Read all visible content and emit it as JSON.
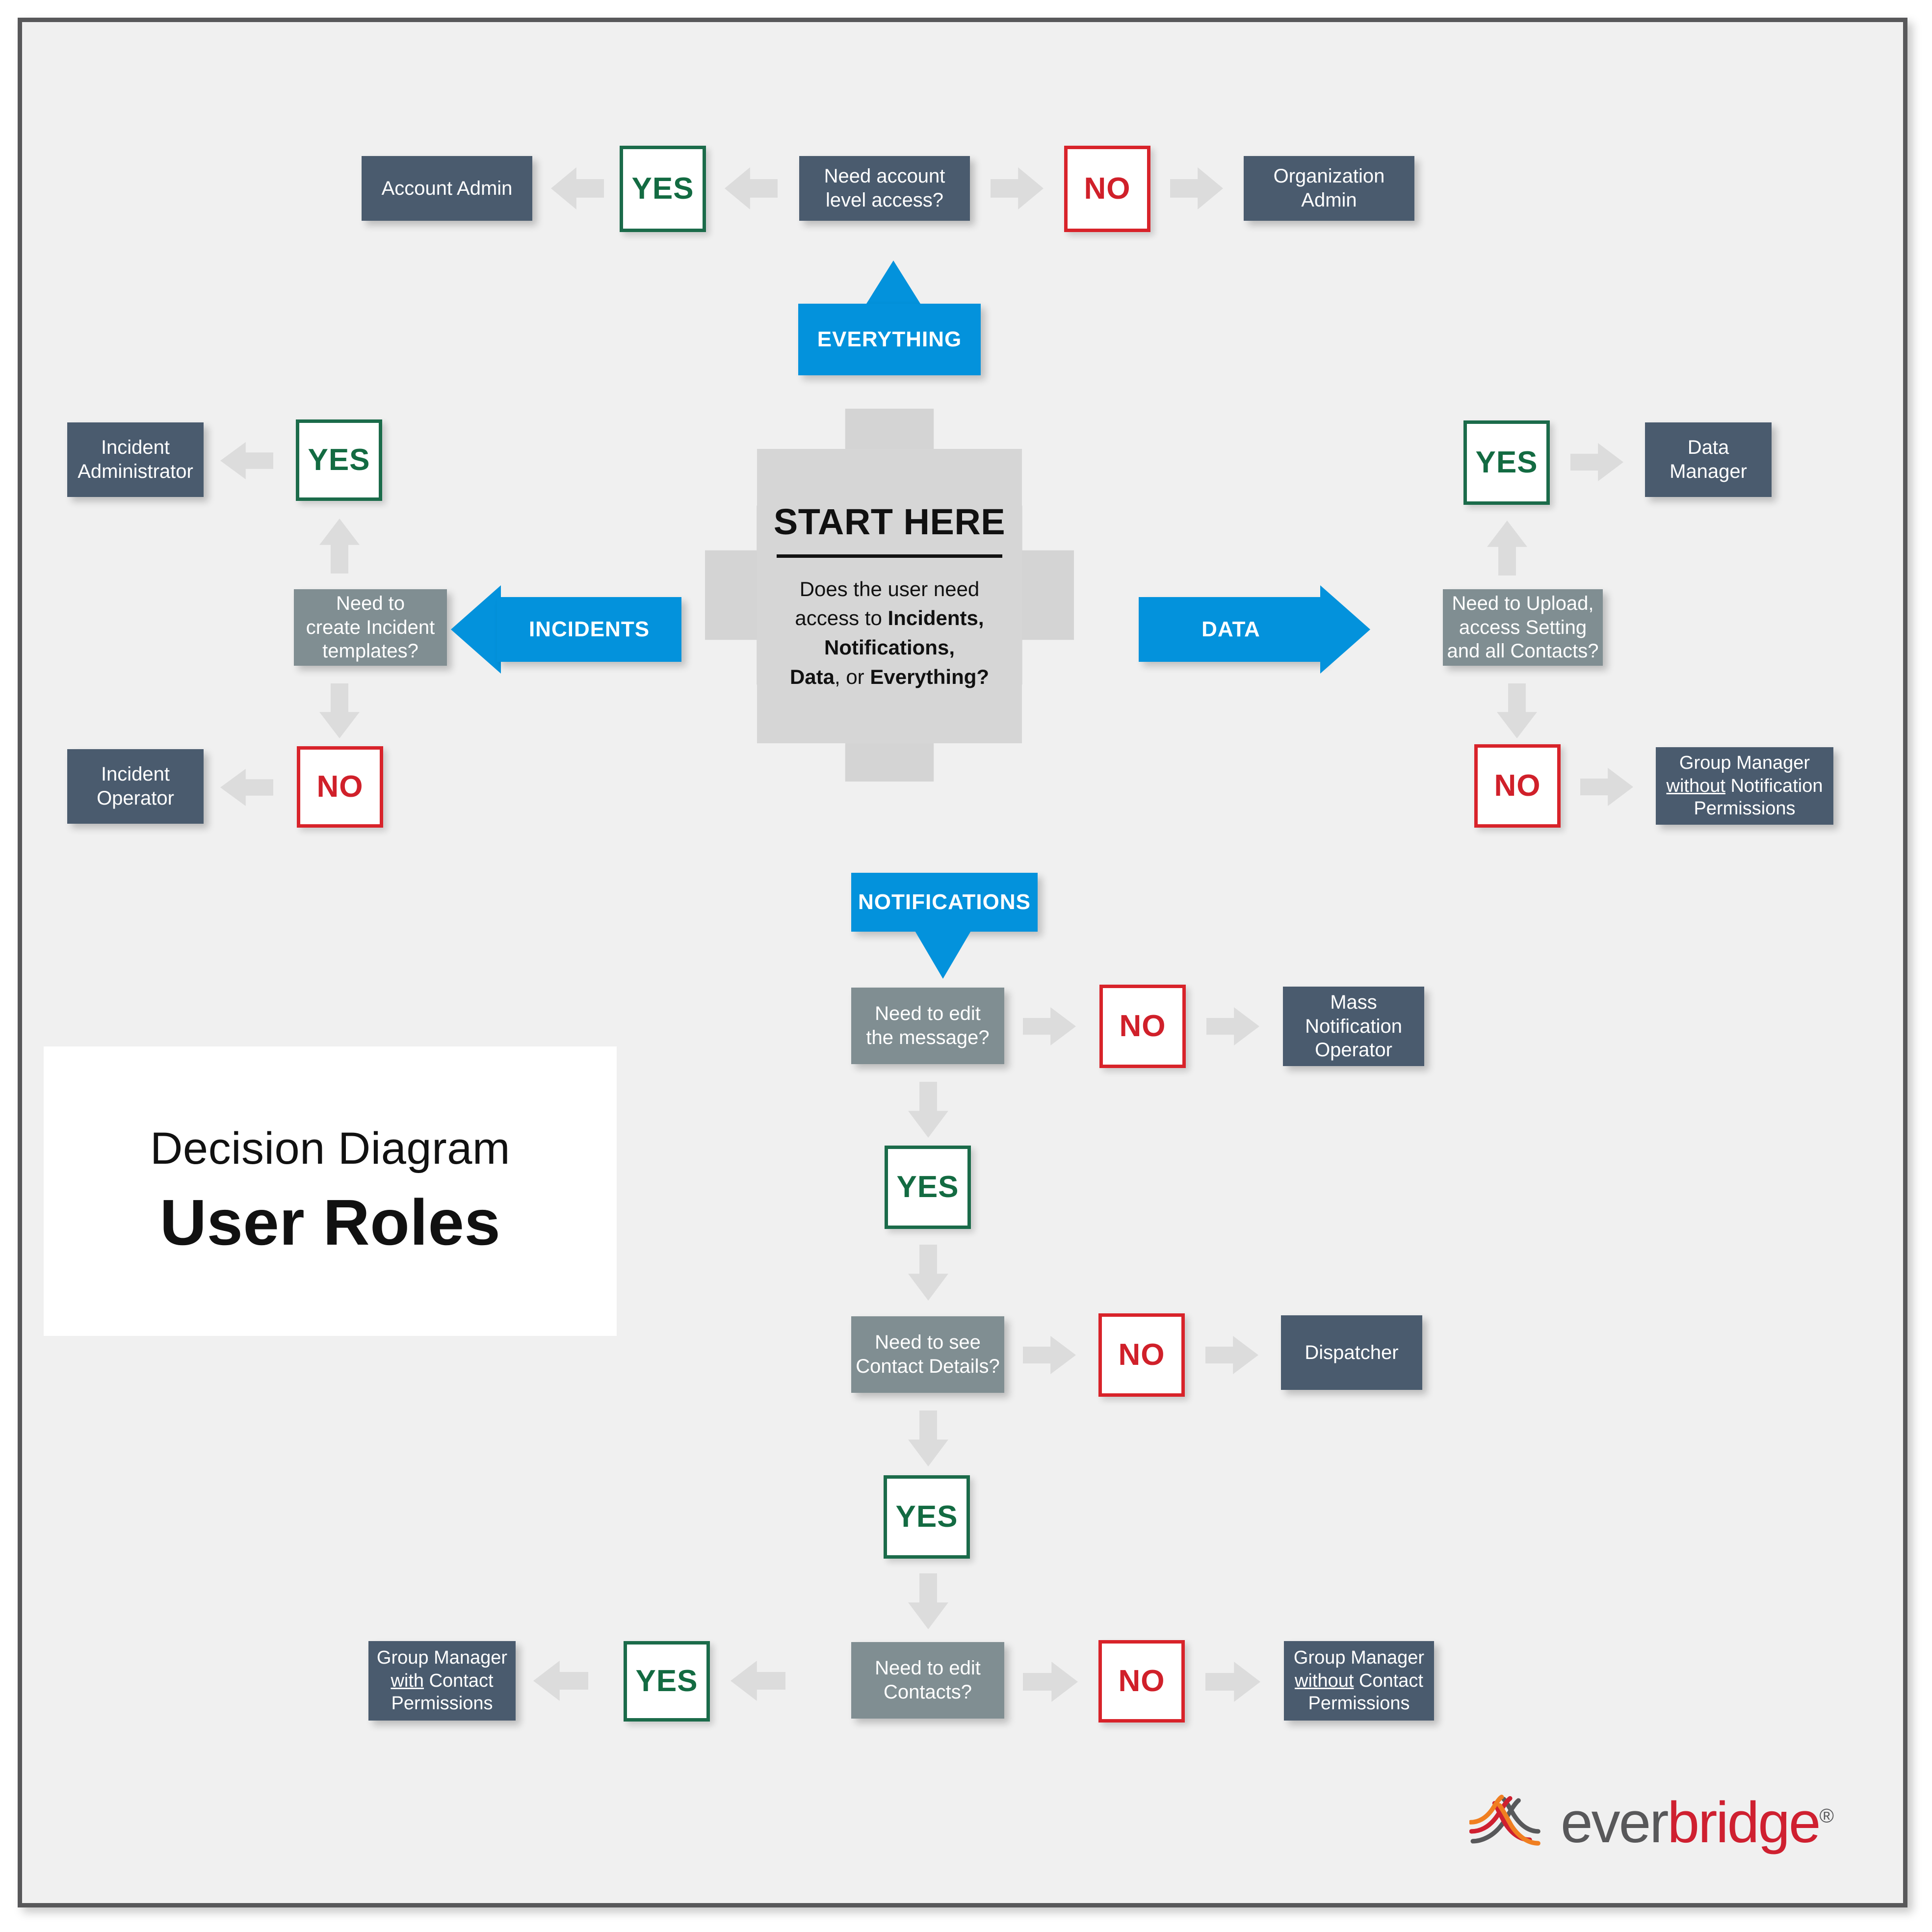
{
  "title_plate": {
    "subtitle": "Decision Diagram",
    "title": "User Roles"
  },
  "logo": {
    "mark": "everbridge-arcs-logo-mark",
    "word_first": "ever",
    "word_second": "bridge",
    "registered": "®",
    "colors": {
      "gray": "#58585a",
      "red": "#cf2030",
      "orange": "#f07f21"
    }
  },
  "colors": {
    "background": "#f0f0f0",
    "frame_border": "#58585a",
    "role_box": "#4a5b6e",
    "question_box": "#808e92",
    "accent_blue": "#0392dc",
    "yes_green": "#136b42",
    "no_red": "#d0202a",
    "arrow_gray": "#dcdcdc",
    "start_gray": "#d6d6d6"
  },
  "start": {
    "title": "START HERE",
    "question_line1": "Does the user need",
    "question_line2_plain": "access to ",
    "question_line2_bold": "Incidents,",
    "question_line3_bold": "Notifications,",
    "question_line4_bold1": "Data",
    "question_line4_plain": ", or ",
    "question_line4_bold2": "Everything?"
  },
  "branch_tags": {
    "everything": "EVERYTHING",
    "incidents": "INCIDENTS",
    "data": "DATA",
    "notifications": "NOTIFICATIONS"
  },
  "labels": {
    "yes": "YES",
    "no": "NO"
  },
  "everything_branch": {
    "question": "Need account level access?",
    "yes_role": "Account Admin",
    "no_role": "Organization Admin"
  },
  "incidents_branch": {
    "question_line1": "Need to",
    "question_line2": "create Incident",
    "question_line3": "templates?",
    "yes_role_line1": "Incident",
    "yes_role_line2": "Administrator",
    "no_role_line1": "Incident",
    "no_role_line2": "Operator"
  },
  "data_branch": {
    "question_line1": "Need to Upload,",
    "question_line2": "access Setting",
    "question_line3": "and all Contacts?",
    "yes_role_line1": "Data",
    "yes_role_line2": "Manager",
    "no_role_line1": "Group Manager",
    "no_role_underline": "without",
    "no_role_line2_rest": " Notification",
    "no_role_line3": "Permissions"
  },
  "notifications_branch": {
    "q1_line1": "Need to edit",
    "q1_line2": "the message?",
    "q1_no_role_line1": "Mass",
    "q1_no_role_line2": "Notification",
    "q1_no_role_line3": "Operator",
    "q2_line1": "Need to see",
    "q2_line2": "Contact Details?",
    "q2_no_role": "Dispatcher",
    "q3_line1": "Need to edit",
    "q3_line2": "Contacts?",
    "q3_yes_role_line1": "Group Manager",
    "q3_yes_role_underline": "with",
    "q3_yes_role_line2_rest": " Contact",
    "q3_yes_role_line3": "Permissions",
    "q3_no_role_line1": "Group Manager",
    "q3_no_role_underline": "without",
    "q3_no_role_line2_rest": " Contact",
    "q3_no_role_line3": "Permissions"
  }
}
